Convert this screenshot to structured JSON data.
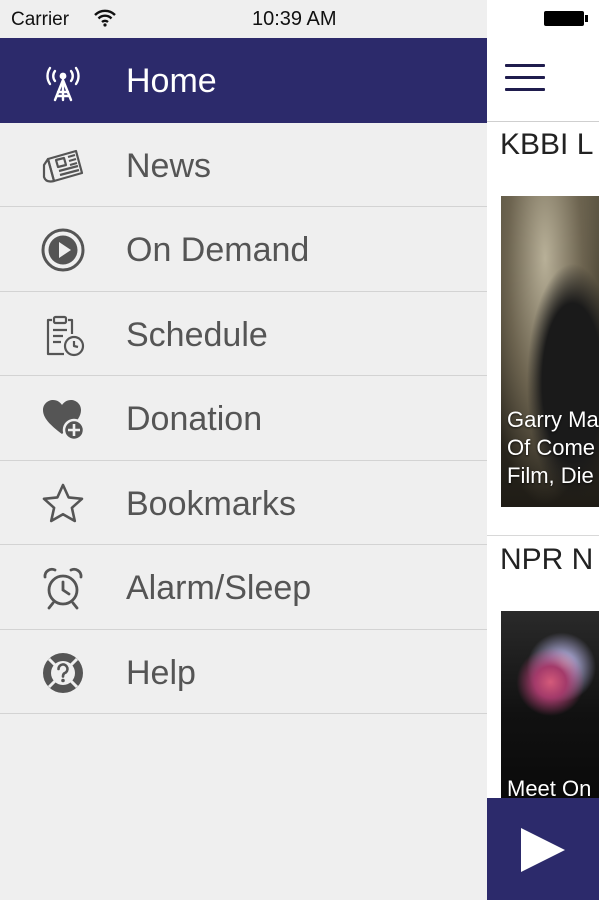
{
  "status_bar": {
    "carrier": "Carrier",
    "time": "10:39 AM"
  },
  "drawer": {
    "accent_color": "#2c2a6b",
    "items": [
      {
        "label": "Home",
        "icon": "radio-tower-icon",
        "active": true
      },
      {
        "label": "News",
        "icon": "newspaper-icon"
      },
      {
        "label": "On Demand",
        "icon": "play-circle-icon"
      },
      {
        "label": "Schedule",
        "icon": "clipboard-clock-icon"
      },
      {
        "label": "Donation",
        "icon": "heart-plus-icon"
      },
      {
        "label": "Bookmarks",
        "icon": "star-icon"
      },
      {
        "label": "Alarm/Sleep",
        "icon": "alarm-clock-icon"
      },
      {
        "label": "Help",
        "icon": "help-lifebuoy-icon"
      }
    ]
  },
  "content": {
    "sections": [
      {
        "title": "KBBI L",
        "caption_lines": [
          "Garry Ma",
          "Of Come",
          "Film, Die"
        ]
      },
      {
        "title": "NPR N",
        "caption_lines": [
          "Meet On"
        ]
      }
    ],
    "player": {
      "icon": "play-icon"
    }
  }
}
